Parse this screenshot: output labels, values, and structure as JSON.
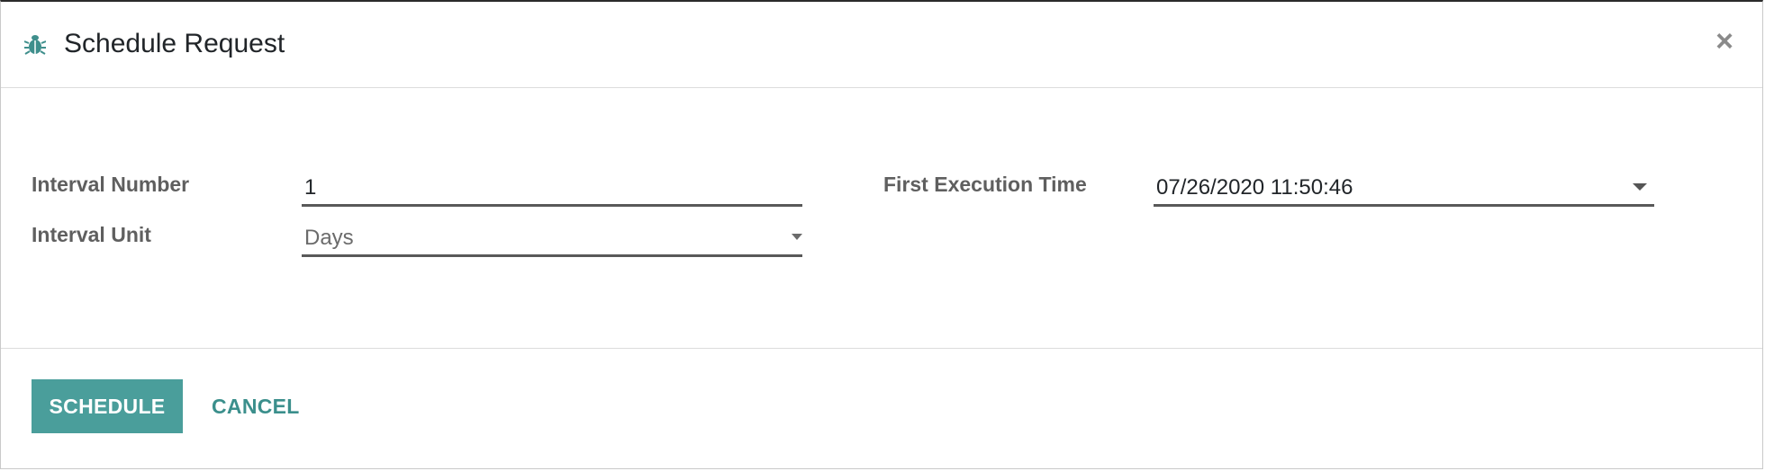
{
  "dialog": {
    "title": "Schedule Request",
    "title_icon": "bug-icon",
    "close_label": "×"
  },
  "form": {
    "interval_number": {
      "label": "Interval Number",
      "value": "1"
    },
    "interval_unit": {
      "label": "Interval Unit",
      "value": "Days"
    },
    "first_execution_time": {
      "label": "First Execution Time",
      "value": "07/26/2020 11:50:46"
    }
  },
  "footer": {
    "schedule_label": "SCHEDULE",
    "cancel_label": "CANCEL"
  },
  "colors": {
    "accent": "#4a9e9b",
    "link": "#3b8f8c"
  }
}
